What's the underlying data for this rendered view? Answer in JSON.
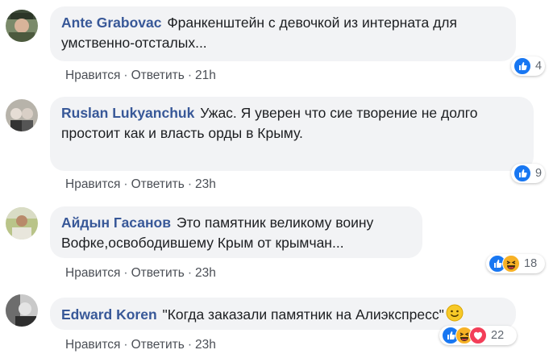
{
  "comments": [
    {
      "author": "Ante Grabovac",
      "text": "Франкенштейн с девочкой из интерната для умственно-отсталых...",
      "like": "Нравится",
      "reply": "Ответить",
      "time": "21h",
      "reaction_count": "4",
      "reactions": [
        "like-icon"
      ]
    },
    {
      "author": "Ruslan Lukyanchuk",
      "text": "Ужас. Я уверен что сие творение не долго простоит как и власть орды в Крыму.",
      "like": "Нравится",
      "reply": "Ответить",
      "time": "23h",
      "reaction_count": "9",
      "reactions": [
        "like-icon"
      ]
    },
    {
      "author": "Айдын Гасанов",
      "text": "Это памятник великому воину Вофке,освободившему Крым от крымчан...",
      "like": "Нравится",
      "reply": "Ответить",
      "time": "23h",
      "reaction_count": "18",
      "reactions": [
        "like-icon",
        "haha-icon"
      ]
    },
    {
      "author": "Edward Koren",
      "text": "\"Когда заказали памятник на Алиэкспресс\"",
      "like": "Нравится",
      "reply": "Ответить",
      "time": "23h",
      "reaction_count": "22",
      "reactions": [
        "like-icon",
        "haha-icon",
        "love-icon"
      ]
    }
  ],
  "colors": {
    "author": "#385898",
    "bubble": "#f2f3f5",
    "like": "#1877f2",
    "haha": "#f7b125",
    "love": "#f33e58"
  }
}
